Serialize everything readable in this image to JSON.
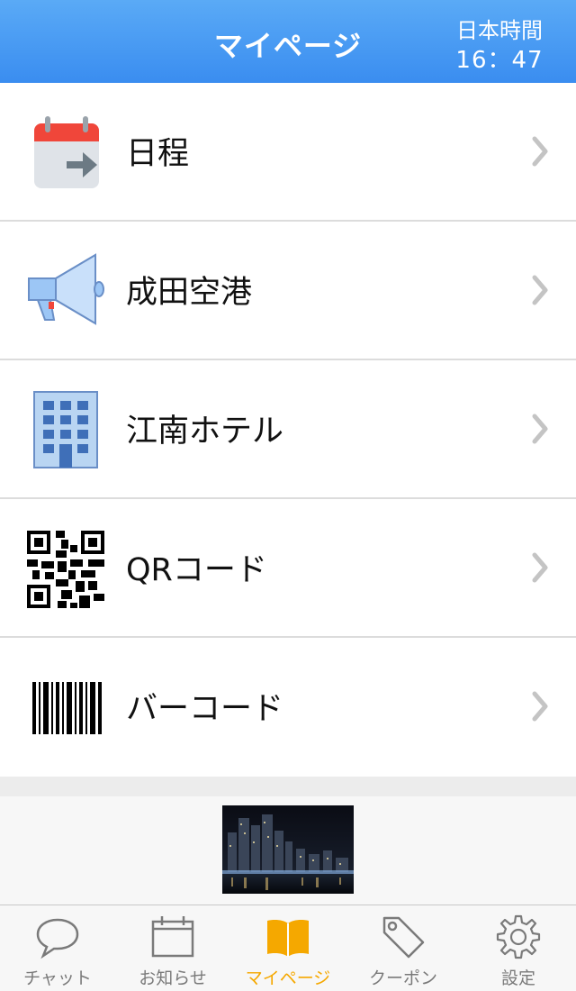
{
  "header": {
    "title": "マイページ",
    "clock_label": "日本時間",
    "clock_time": "16：47"
  },
  "menu": {
    "items": [
      {
        "label": "日程",
        "icon": "calendar-arrow-icon"
      },
      {
        "label": "成田空港",
        "icon": "megaphone-icon"
      },
      {
        "label": "江南ホテル",
        "icon": "building-icon"
      },
      {
        "label": "QRコード",
        "icon": "qr-code-icon"
      },
      {
        "label": "バーコード",
        "icon": "barcode-icon"
      }
    ]
  },
  "tabbar": {
    "tabs": [
      {
        "label": "チャット",
        "icon": "chat-bubble-icon",
        "active": false
      },
      {
        "label": "お知らせ",
        "icon": "calendar-icon",
        "active": false
      },
      {
        "label": "マイページ",
        "icon": "book-icon",
        "active": true
      },
      {
        "label": "クーポン",
        "icon": "tag-icon",
        "active": false
      },
      {
        "label": "設定",
        "icon": "gear-icon",
        "active": false
      }
    ]
  },
  "colors": {
    "header_top": "#5aaaf6",
    "header_bottom": "#3a8df0",
    "active_tab": "#f5a800",
    "inactive_tab": "#7a7a7a"
  }
}
